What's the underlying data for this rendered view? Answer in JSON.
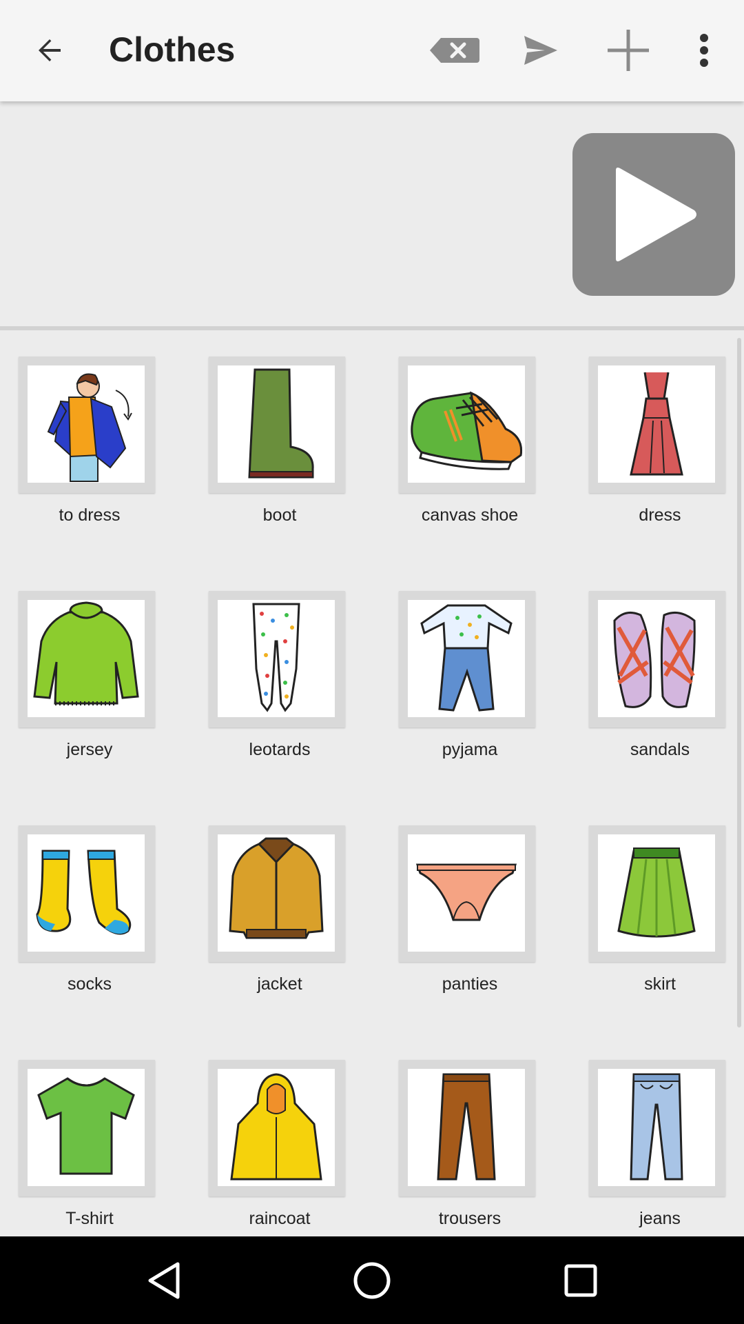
{
  "app_bar": {
    "title": "Clothes",
    "icons": [
      "back-arrow-icon",
      "backspace-icon",
      "send-icon",
      "add-icon",
      "more-vert-icon"
    ]
  },
  "sentence_bar": {
    "play_icon": "play-icon"
  },
  "pictograms": [
    {
      "label": "to dress",
      "icon": "to-dress-icon"
    },
    {
      "label": "boot",
      "icon": "boot-icon"
    },
    {
      "label": "canvas shoe",
      "icon": "canvas-shoe-icon"
    },
    {
      "label": "dress",
      "icon": "dress-icon"
    },
    {
      "label": "jersey",
      "icon": "jersey-icon"
    },
    {
      "label": "leotards",
      "icon": "leotards-icon"
    },
    {
      "label": "pyjama",
      "icon": "pyjama-icon"
    },
    {
      "label": "sandals",
      "icon": "sandals-icon"
    },
    {
      "label": "socks",
      "icon": "socks-icon"
    },
    {
      "label": "jacket",
      "icon": "jacket-icon"
    },
    {
      "label": "panties",
      "icon": "panties-icon"
    },
    {
      "label": "skirt",
      "icon": "skirt-icon"
    },
    {
      "label": "T-shirt",
      "icon": "tshirt-icon"
    },
    {
      "label": "raincoat",
      "icon": "raincoat-icon"
    },
    {
      "label": "trousers",
      "icon": "trousers-icon"
    },
    {
      "label": "jeans",
      "icon": "jeans-icon"
    }
  ],
  "nav_bar": {
    "icons": [
      "nav-back-icon",
      "nav-home-icon",
      "nav-recents-icon"
    ]
  },
  "colors": {
    "app_bar_bg": "#f5f5f5",
    "page_bg": "#ececec",
    "play_button": "#888888",
    "tile_frame": "#d9d9d9",
    "nav_bar_bg": "#000000"
  }
}
